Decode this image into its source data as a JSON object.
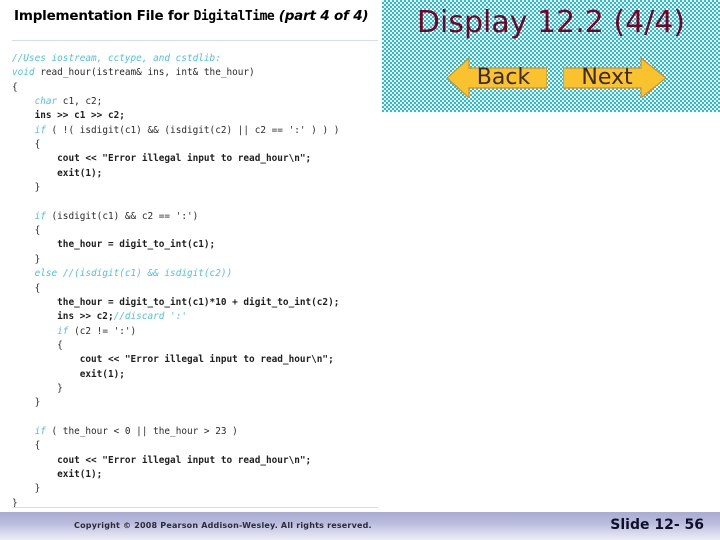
{
  "header": {
    "title_prefix": "Implementation File for ",
    "title_mono": "DigitalTime",
    "title_suffix": " (part 4 of 4)",
    "title_full": "Implementation File for DigitalTime (part 4 of 4)"
  },
  "display_panel": {
    "label": "Display 12.2 (4/4)",
    "background_color": "#19c3dd",
    "label_color": "#7b0023"
  },
  "nav": {
    "back_label": "Back",
    "next_label": "Next",
    "button_fill": "#f9c22e",
    "button_text_color": "#3d2b16"
  },
  "code": {
    "language": "cpp",
    "comment_color": "#4fc3d9",
    "text_color": "#2b2b2b",
    "lines": [
      "//Uses iostream, cctype, and cstdlib:",
      "void read_hour(istream& ins, int& the_hour)",
      "{",
      "    char c1, c2;",
      "    ins >> c1 >> c2;",
      "    if ( !( isdigit(c1) && (isdigit(c2) || c2 == ':' ) ) )",
      "    {",
      "        cout << \"Error illegal input to read_hour\\n\";",
      "        exit(1);",
      "    }",
      "",
      "    if (isdigit(c1) && c2 == ':')",
      "    {",
      "        the_hour = digit_to_int(c1);",
      "    }",
      "    else //(isdigit(c1) && isdigit(c2))",
      "    {",
      "        the_hour = digit_to_int(c1)*10 + digit_to_int(c2);",
      "        ins >> c2;//discard ':'",
      "        if (c2 != ':')",
      "        {",
      "            cout << \"Error illegal input to read_hour\\n\";",
      "            exit(1);",
      "        }",
      "    }",
      "",
      "    if ( the_hour < 0 || the_hour > 23 )",
      "    {",
      "        cout << \"Error illegal input to read_hour\\n\";",
      "        exit(1);",
      "    }",
      "}"
    ]
  },
  "footer": {
    "copyright": "Copyright © 2008 Pearson Addison-Wesley.  All rights reserved.",
    "slide_number": "Slide 12- 56"
  }
}
